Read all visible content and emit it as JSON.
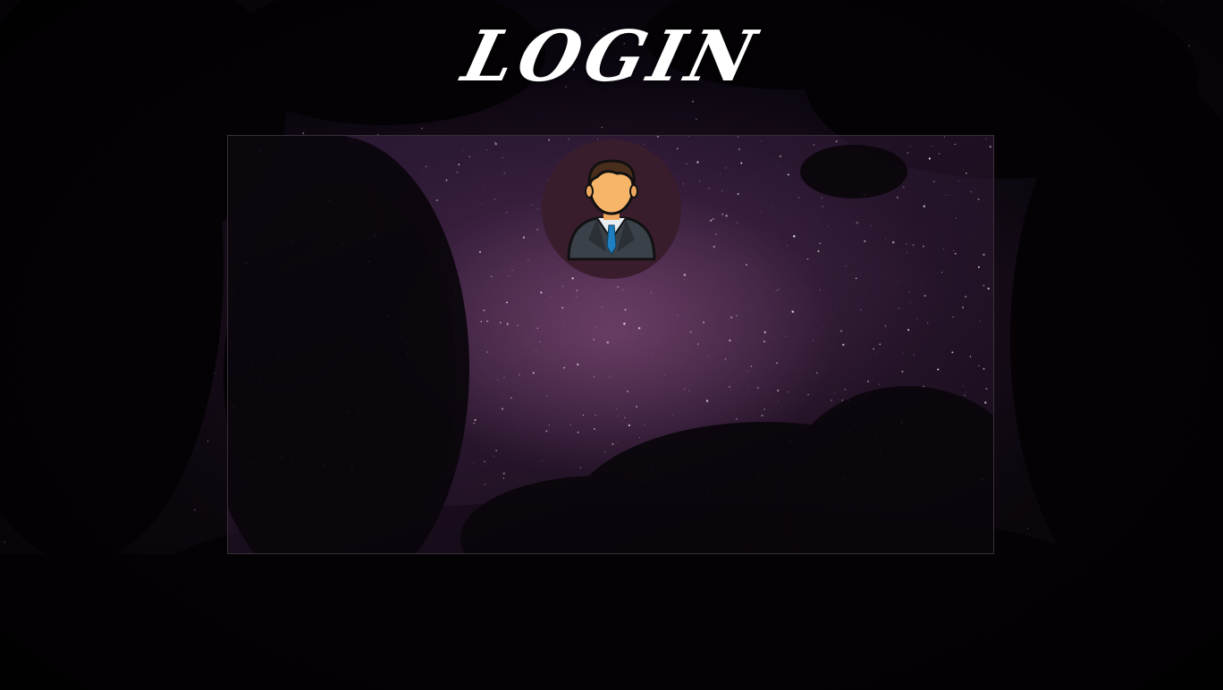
{
  "title": "LOGIN",
  "avatar": {
    "icon": "user-avatar-icon"
  },
  "colors": {
    "background": "#0b0610",
    "panel_border": "#3c323c",
    "avatar_bg": "#3a1d2c",
    "title_text": "#ffffff"
  }
}
